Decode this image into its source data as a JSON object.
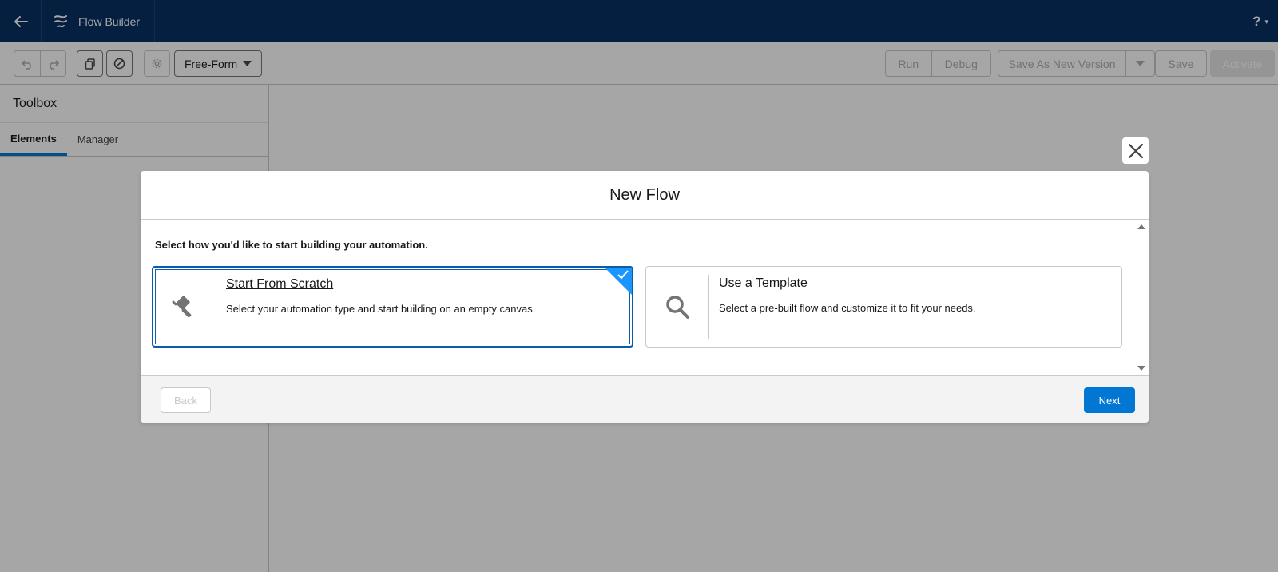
{
  "header": {
    "app_title": "Flow Builder",
    "back_icon": "arrow-left-icon",
    "brand_icon": "flow-icon",
    "help_label": "?",
    "help_caret": "▾"
  },
  "toolbar": {
    "canvas_mode": "Free-Form",
    "run_label": "Run",
    "debug_label": "Debug",
    "save_as_new_version_label": "Save As New Version",
    "save_label": "Save",
    "activate_label": "Activate"
  },
  "toolbox": {
    "title": "Toolbox",
    "tabs": [
      {
        "label": "Elements",
        "active": true
      },
      {
        "label": "Manager",
        "active": false
      }
    ]
  },
  "modal": {
    "title": "New Flow",
    "prompt": "Select how you'd like to start building your automation.",
    "options": [
      {
        "title": "Start From Scratch",
        "description": "Select your automation type and start building on an empty canvas.",
        "icon": "paint-roller-icon",
        "selected": true
      },
      {
        "title": "Use a Template",
        "description": "Select a pre-built flow and customize it to fit your needs.",
        "icon": "search-icon",
        "selected": false
      }
    ],
    "back_label": "Back",
    "next_label": "Next"
  },
  "colors": {
    "header_bg": "#032d60",
    "brand_blue": "#0176d3",
    "selected_border": "#0b5cab",
    "check_corner": "#1b96ff"
  }
}
